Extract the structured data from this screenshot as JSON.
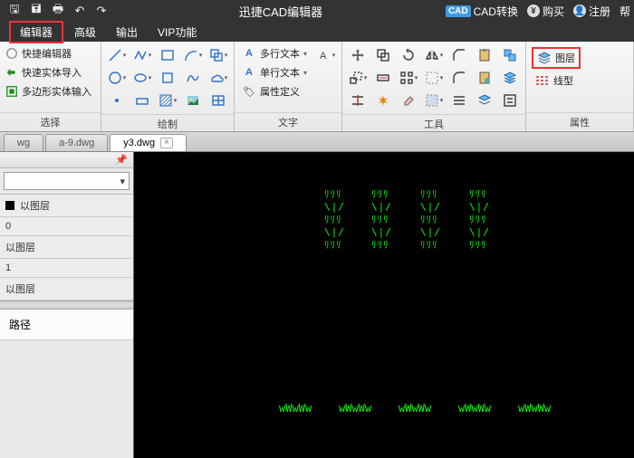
{
  "titlebar": {
    "title": "迅捷CAD编辑器",
    "right": {
      "convert": "CAD转换",
      "buy": "购买",
      "register": "注册",
      "help": "帮"
    }
  },
  "menu": {
    "editor": "编辑器",
    "advanced": "高级",
    "output": "输出",
    "vip": "VIP功能"
  },
  "ribbon": {
    "select": {
      "label": "选择",
      "quick_editor": "快捷编辑器",
      "quick_import": "快速实体导入",
      "polygon_import": "多边形实体输入"
    },
    "draw": {
      "label": "绘制"
    },
    "text": {
      "label": "文字",
      "multiline": "多行文本",
      "singleline": "单行文本",
      "attrdef": "属性定义"
    },
    "tools": {
      "label": "工具"
    },
    "attr": {
      "label": "属性",
      "layer": "图层",
      "linetype": "线型"
    }
  },
  "doctabs": {
    "t0": "wg",
    "t1": "a-9.dwg",
    "t2": "y3.dwg"
  },
  "side": {
    "rows": {
      "r1": "以图层",
      "r2": "0",
      "r3": "以图层",
      "r4": "1",
      "r5": "以图层"
    },
    "path": "路径"
  }
}
